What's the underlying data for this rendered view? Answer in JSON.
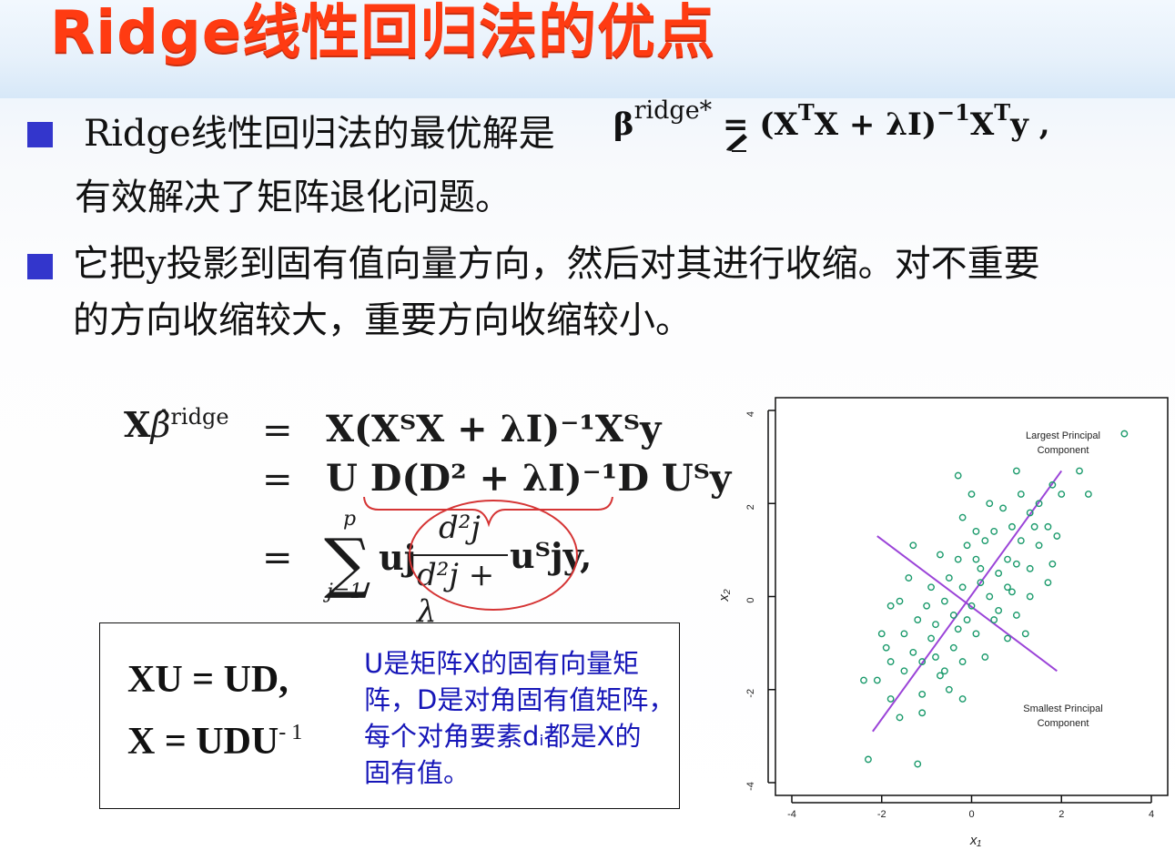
{
  "slide": {
    "title": "Ridge线性回归法的优点",
    "bullet1": {
      "line1": "Ridge线性回归法的最优解是",
      "formula": {
        "beta": "β",
        "sup": "ridge*",
        "eq": "= (X",
        "t": "T",
        "mid": "X + λI)",
        "neg1": "−1",
        "end": "X",
        "t2": "T",
        "y": "y  ,"
      },
      "line2": "有效解决了矩阵退化问题。"
    },
    "bullet2": {
      "line1": "它把y投影到固有值向量方向，然后对其进行收缩。对不重要",
      "line2": "的方向收缩较大，重要方向收缩较小。"
    },
    "formula_block": {
      "left": "X",
      "hat": "β̂",
      "sup": "ridge",
      "eq_sign": "=",
      "r1": "X(XᵀX + λI)⁻¹Xᵀy",
      "r2": "U D(D² + λI)⁻¹D Uᵀy",
      "sum": "∑",
      "p": "p",
      "j1": "j=1",
      "uj": "uj",
      "frac_num": "d²j",
      "frac_den": "d²j + λ",
      "rest3": "uᵀjy,"
    },
    "box": {
      "eq1": "XU =  UD,",
      "eq2_main": "X =  UDU",
      "eq2_sup": "- 1",
      "note": [
        "U是矩阵X的固有向量矩",
        "阵，D是对角固有值矩阵，",
        "每个对角要素dᵢ都是X的",
        "固有值。"
      ]
    }
  },
  "chart_data": {
    "type": "scatter",
    "title": "",
    "xlabel": "x₁",
    "ylabel": "x₂",
    "xlim": [
      -4,
      4
    ],
    "ylim": [
      -4,
      4
    ],
    "xticks": [
      "-4",
      "-2",
      "0",
      "2",
      "4"
    ],
    "yticks": [
      "4",
      "2",
      "0",
      "-2",
      "-4"
    ],
    "annotations": [
      "Largest Principal Component",
      "Smallest Principal Component"
    ],
    "series": [
      {
        "points": [
          [
            -2.3,
            -3.5
          ],
          [
            -1.2,
            -3.6
          ],
          [
            -1.8,
            -2.2
          ],
          [
            -1.6,
            -2.6
          ],
          [
            -1.1,
            -2.1
          ],
          [
            -1.1,
            -2.5
          ],
          [
            -0.5,
            -2.0
          ],
          [
            -0.2,
            -2.2
          ],
          [
            -2.1,
            -1.8
          ],
          [
            -1.8,
            -1.4
          ],
          [
            -1.5,
            -1.6
          ],
          [
            -1.3,
            -1.2
          ],
          [
            -1.1,
            -1.4
          ],
          [
            -0.9,
            -0.9
          ],
          [
            -0.8,
            -1.3
          ],
          [
            -0.6,
            -1.6
          ],
          [
            -0.4,
            -1.1
          ],
          [
            -0.3,
            -0.7
          ],
          [
            -0.2,
            -1.4
          ],
          [
            0.1,
            -0.8
          ],
          [
            0.3,
            -1.3
          ],
          [
            0.5,
            -0.5
          ],
          [
            0.8,
            -0.9
          ],
          [
            1.0,
            -0.4
          ],
          [
            1.2,
            -0.8
          ],
          [
            -1.5,
            -0.8
          ],
          [
            -1.2,
            -0.5
          ],
          [
            -1.0,
            -0.2
          ],
          [
            -0.8,
            -0.6
          ],
          [
            -0.6,
            -0.1
          ],
          [
            -0.4,
            -0.4
          ],
          [
            -0.2,
            0.2
          ],
          [
            0.0,
            -0.2
          ],
          [
            0.2,
            0.3
          ],
          [
            0.4,
            0.0
          ],
          [
            0.6,
            0.5
          ],
          [
            0.8,
            0.2
          ],
          [
            1.0,
            0.7
          ],
          [
            1.1,
            1.2
          ],
          [
            1.3,
            0.6
          ],
          [
            1.5,
            1.1
          ],
          [
            1.7,
            1.5
          ],
          [
            -0.3,
            0.8
          ],
          [
            -0.1,
            1.1
          ],
          [
            0.1,
            0.8
          ],
          [
            0.3,
            1.2
          ],
          [
            0.5,
            1.4
          ],
          [
            0.7,
            1.9
          ],
          [
            0.9,
            1.5
          ],
          [
            1.1,
            2.2
          ],
          [
            1.3,
            1.8
          ],
          [
            1.5,
            2.0
          ],
          [
            1.8,
            2.4
          ],
          [
            2.0,
            2.2
          ],
          [
            2.4,
            2.7
          ],
          [
            2.6,
            2.2
          ],
          [
            3.4,
            3.5
          ],
          [
            0.0,
            2.2
          ],
          [
            0.4,
            2.0
          ],
          [
            -0.2,
            1.7
          ],
          [
            0.1,
            1.4
          ],
          [
            -0.7,
            0.9
          ],
          [
            -1.4,
            0.4
          ],
          [
            -0.5,
            0.4
          ],
          [
            0.2,
            0.6
          ],
          [
            0.9,
            0.1
          ],
          [
            -0.9,
            0.2
          ],
          [
            -1.8,
            -0.2
          ],
          [
            -2.0,
            -0.8
          ],
          [
            -0.1,
            -0.5
          ],
          [
            0.6,
            -0.3
          ],
          [
            1.3,
            0.0
          ],
          [
            1.8,
            0.7
          ],
          [
            -0.7,
            -1.7
          ],
          [
            -1.9,
            -1.1
          ],
          [
            -2.4,
            -1.8
          ],
          [
            -0.3,
            2.6
          ],
          [
            1.0,
            2.7
          ],
          [
            1.9,
            1.3
          ],
          [
            0.8,
            0.8
          ],
          [
            -1.3,
            1.1
          ],
          [
            -1.6,
            -0.1
          ],
          [
            1.7,
            0.3
          ],
          [
            1.4,
            1.5
          ]
        ],
        "color": "#1a9a6b"
      }
    ],
    "lines": [
      {
        "name": "largest",
        "from": [
          -2.2,
          -2.9
        ],
        "to": [
          2.0,
          2.7
        ],
        "color": "#9b44d8"
      },
      {
        "name": "smallest",
        "from": [
          -2.1,
          1.3
        ],
        "to": [
          1.9,
          -1.6
        ],
        "color": "#9b44d8"
      }
    ]
  }
}
